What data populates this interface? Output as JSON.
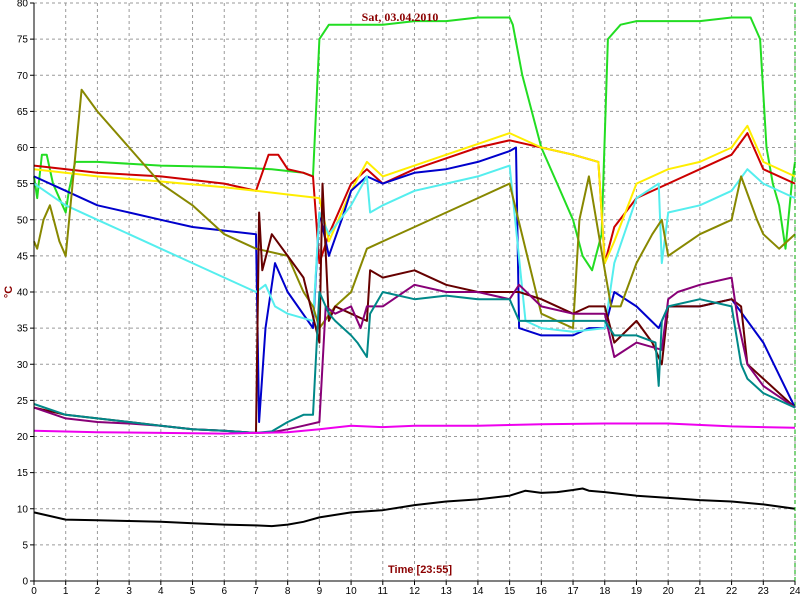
{
  "chart_data": {
    "type": "line",
    "title": "Sat, 03.04.2010",
    "xlabel": "Time [23:55]",
    "ylabel": "°C",
    "xlim": [
      0,
      24
    ],
    "ylim": [
      0,
      80
    ],
    "xticks": [
      "0",
      "1",
      "2",
      "3",
      "4",
      "5",
      "6",
      "7",
      "8",
      "9",
      "10",
      "11",
      "12",
      "13",
      "14",
      "15",
      "16",
      "17",
      "18",
      "19",
      "20",
      "21",
      "22",
      "23",
      "24"
    ],
    "yticks": [
      "0",
      "5",
      "10",
      "15",
      "20",
      "25",
      "30",
      "35",
      "40",
      "45",
      "50",
      "55",
      "60",
      "65",
      "70",
      "75",
      "80"
    ],
    "grid": true,
    "series": [
      {
        "color": "#22dd22",
        "x": [
          0,
          0.1,
          0.25,
          0.4,
          0.6,
          0.9,
          1.0,
          1.1,
          1.3,
          2,
          4,
          6,
          7.5,
          8.5,
          8.8,
          9.0,
          9.3,
          9.7,
          10,
          10.5,
          11,
          12,
          13,
          14,
          15,
          15.1,
          15.4,
          16,
          16.5,
          17,
          17.3,
          17.6,
          17.9,
          18.1,
          18.5,
          19,
          20,
          21,
          22,
          22.6,
          22.9,
          23.1,
          23.3,
          23.5,
          23.7,
          23.9,
          24
        ],
        "y": [
          56,
          53,
          59,
          59,
          55,
          52,
          51,
          54,
          58,
          58,
          57.5,
          57.3,
          57,
          56.5,
          56,
          75,
          77,
          77,
          77,
          77,
          77,
          77.5,
          77.5,
          78,
          78,
          77,
          70,
          60,
          55,
          50,
          45,
          43,
          48,
          75,
          77,
          77.5,
          77.5,
          77.5,
          78,
          78,
          75,
          60,
          55,
          52,
          46,
          55,
          58
        ]
      },
      {
        "color": "#cc0000",
        "x": [
          0,
          2,
          4,
          6,
          7,
          7.4,
          7.7,
          8,
          8.5,
          8.8,
          9.0,
          9.3,
          10,
          10.5,
          11,
          12,
          13,
          14,
          15,
          16,
          17,
          17.8,
          18,
          18.3,
          19,
          20,
          21,
          22,
          22.5,
          23,
          24
        ],
        "y": [
          57.5,
          56.5,
          56,
          55,
          54,
          59,
          59,
          57,
          56.5,
          56,
          44,
          48,
          55,
          57,
          55,
          57,
          58.5,
          60,
          61,
          60,
          59,
          58,
          44,
          49,
          53,
          55,
          57,
          59,
          62,
          57,
          55
        ]
      },
      {
        "color": "#ffee00",
        "x": [
          0,
          2,
          4,
          6,
          7,
          8,
          9,
          9.3,
          10,
          10.5,
          11,
          12,
          13,
          14,
          15,
          16,
          17,
          17.8,
          18,
          18.3,
          19,
          20,
          21,
          22,
          22.5,
          23,
          24
        ],
        "y": [
          57,
          56,
          55.3,
          54.5,
          54,
          53.5,
          53,
          47,
          54,
          58,
          56,
          57.5,
          59,
          60.5,
          62,
          60,
          59,
          58,
          44,
          47,
          55,
          57,
          58,
          60,
          63,
          58,
          56
        ]
      },
      {
        "color": "#0000cc",
        "x": [
          0,
          1,
          2,
          3,
          4,
          5,
          6,
          7,
          7.1,
          7.3,
          7.6,
          8,
          8.8,
          9.0,
          9.3,
          9.7,
          10,
          10.5,
          11,
          12,
          13,
          14,
          15,
          15.2,
          15.3,
          16,
          17,
          17.5,
          18,
          18.3,
          19,
          19.7,
          20,
          21,
          22,
          23,
          24
        ],
        "y": [
          56,
          54,
          52,
          51,
          50,
          49,
          48.5,
          48,
          22,
          35,
          44,
          40,
          35,
          51,
          45,
          50,
          54,
          56,
          55,
          56.5,
          57,
          58,
          59.5,
          60,
          35,
          34,
          34,
          35,
          35,
          40,
          38,
          35,
          38,
          38,
          39,
          33,
          24
        ]
      },
      {
        "color": "#55eeee",
        "x": [
          0,
          1,
          2,
          3,
          4,
          5,
          6,
          7,
          7.3,
          7.6,
          8,
          8.8,
          9.0,
          9.3,
          10,
          10.5,
          10.6,
          11,
          12,
          13,
          14,
          15,
          15.5,
          16,
          17,
          18,
          18.3,
          19,
          19.7,
          19.8,
          20,
          21,
          22,
          22.5,
          23,
          24
        ],
        "y": [
          55,
          52,
          50,
          48,
          46,
          44,
          42,
          40,
          41,
          38,
          37,
          36,
          51,
          48,
          52,
          56,
          51,
          52,
          54,
          55,
          56,
          57.5,
          36,
          35,
          34.5,
          35,
          44,
          53,
          55,
          44,
          51,
          52,
          54,
          57,
          55,
          53
        ]
      },
      {
        "color": "#888800",
        "x": [
          0,
          0.1,
          0.3,
          0.5,
          0.8,
          1.0,
          1.5,
          2,
          3,
          4,
          5,
          6,
          7,
          8,
          8.5,
          8.8,
          9.0,
          9.5,
          10,
          10.5,
          11,
          12,
          13,
          14,
          15,
          16,
          17,
          17.2,
          17.5,
          18,
          18.2,
          18.5,
          19,
          19.5,
          19.8,
          20,
          21,
          22,
          22.3,
          22.8,
          23,
          23.5,
          24
        ],
        "y": [
          47,
          46,
          50,
          52,
          47,
          45,
          68,
          65,
          60,
          55,
          52,
          48,
          46,
          45,
          40,
          38,
          35,
          38,
          40,
          46,
          47,
          49,
          51,
          53,
          55,
          37,
          35,
          50,
          56,
          43,
          38,
          38,
          44,
          48,
          50,
          45,
          48,
          50,
          56,
          50,
          48,
          46,
          48
        ]
      },
      {
        "color": "#660000",
        "x": [
          0,
          1,
          2,
          3,
          4,
          5,
          6,
          7,
          7.1,
          7.2,
          7.5,
          8,
          8.5,
          9.0,
          9.1,
          9.3,
          9.5,
          10,
          10.5,
          10.6,
          11,
          12,
          13,
          14,
          15,
          15.3,
          16,
          17,
          17.5,
          18,
          18.3,
          19,
          19.5,
          19.8,
          20,
          21,
          22,
          22.3,
          22.5,
          23,
          24
        ],
        "y": [
          24,
          23,
          22.5,
          22,
          21.5,
          21,
          20.8,
          20.5,
          51,
          43,
          48,
          45,
          42,
          33,
          55,
          36,
          38,
          37,
          36,
          43,
          42,
          43,
          41,
          40,
          40,
          40,
          39,
          37,
          38,
          38,
          33,
          36,
          33,
          30,
          38,
          38,
          39,
          38,
          30,
          28,
          24
        ]
      },
      {
        "color": "#880077",
        "x": [
          0,
          1,
          2,
          3,
          4,
          5,
          6,
          7,
          7.5,
          8,
          8.5,
          9,
          9.2,
          9.5,
          10,
          10.3,
          10.5,
          11,
          12,
          13,
          14,
          15,
          15.3,
          16,
          17,
          17.5,
          18,
          18.3,
          19,
          19.8,
          20,
          20.3,
          21,
          22,
          22.2,
          22.5,
          23,
          24
        ],
        "y": [
          24,
          22.5,
          22,
          21.8,
          21.5,
          21,
          20.8,
          20.5,
          20.6,
          21,
          21.5,
          22,
          38,
          37,
          38,
          35,
          38,
          38,
          41,
          40,
          40,
          39,
          41,
          38,
          37,
          37,
          37,
          31,
          33,
          32,
          39,
          40,
          41,
          42,
          36,
          30,
          27,
          24
        ]
      },
      {
        "color": "#008888",
        "x": [
          0,
          1,
          2,
          3,
          4,
          5,
          6,
          7,
          7.5,
          8,
          8.5,
          8.8,
          9.0,
          9.3,
          9.5,
          10,
          10.2,
          10.5,
          10.6,
          11,
          12,
          13,
          14,
          15,
          15.3,
          16,
          17,
          18,
          18.3,
          19,
          19.6,
          19.7,
          19.8,
          20,
          21,
          22,
          22.3,
          22.5,
          23,
          24
        ],
        "y": [
          24.5,
          23,
          22.5,
          22,
          21.5,
          21,
          20.8,
          20.5,
          20.7,
          22,
          23,
          23,
          40,
          37,
          36,
          34,
          33,
          31,
          37,
          40,
          39,
          39.5,
          39,
          39,
          36,
          36,
          36,
          36,
          34,
          34,
          33,
          27,
          36,
          38,
          39,
          38,
          30,
          28,
          26,
          24
        ]
      },
      {
        "color": "#ee00ee",
        "x": [
          0,
          2,
          4,
          6,
          8,
          9,
          10,
          11,
          12,
          14,
          16,
          18,
          20,
          22,
          24
        ],
        "y": [
          20.8,
          20.6,
          20.5,
          20.4,
          20.6,
          21,
          21.5,
          21.3,
          21.5,
          21.5,
          21.7,
          21.8,
          21.8,
          21.4,
          21.2
        ]
      },
      {
        "color": "#000000",
        "x": [
          0,
          0.5,
          1,
          2,
          3,
          4,
          5,
          6,
          7,
          7.5,
          8,
          8.5,
          9,
          10,
          11,
          12,
          13,
          14,
          15,
          15.5,
          16,
          16.5,
          17,
          17.3,
          17.5,
          18,
          19,
          20,
          21,
          22,
          23,
          24
        ],
        "y": [
          9.5,
          9,
          8.5,
          8.4,
          8.3,
          8.2,
          8,
          7.8,
          7.7,
          7.6,
          7.8,
          8.2,
          8.8,
          9.5,
          9.8,
          10.5,
          11,
          11.3,
          11.8,
          12.5,
          12.2,
          12.3,
          12.6,
          12.8,
          12.5,
          12.3,
          11.8,
          11.5,
          11.2,
          11,
          10.6,
          10
        ]
      }
    ]
  }
}
